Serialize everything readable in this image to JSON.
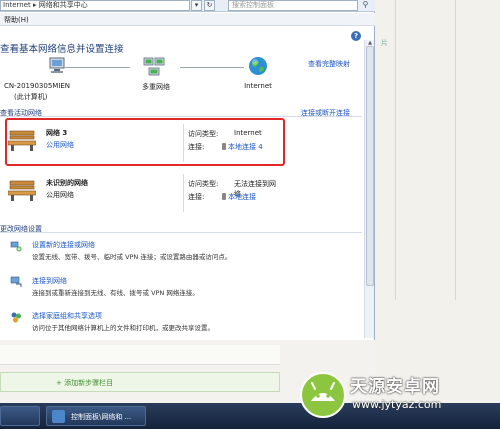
{
  "address": {
    "path": "Internet  ▸  网络和共享中心",
    "search_placeholder": "搜索控制面板"
  },
  "menu": {
    "help": "帮助(H)"
  },
  "title": "查看基本网络信息并设置连接",
  "map": {
    "link": "查看完整映射",
    "computer_name": "CN-20190305MIEN",
    "computer_sub": "(此计算机)",
    "network": "多重网络",
    "internet": "Internet"
  },
  "active_section": {
    "label": "查看活动网络",
    "link": "连接或断开连接"
  },
  "networks": [
    {
      "name": "网络  3",
      "type": "公用网络",
      "access_label": "访问类型:",
      "access_value": "Internet",
      "conn_label": "连接:",
      "conn_value": "本地连接 4"
    },
    {
      "name": "未识别的网络",
      "type": "公用网络",
      "access_label": "访问类型:",
      "access_value": "无法连接到网络",
      "conn_label": "连接:",
      "conn_value": "本地连接"
    }
  ],
  "settings_section": {
    "label": "更改网络设置"
  },
  "tasks": [
    {
      "title": "设置新的连接或网络",
      "desc": "设置无线、宽带、拨号、临时或 VPN 连接；或设置路由器或访问点。"
    },
    {
      "title": "连接到网络",
      "desc": "连接到或重新连接到无线、有线、拨号或 VPN 网络连接。"
    },
    {
      "title": "选择家庭组和共享选项",
      "desc": "访问位于其他网络计算机上的文件和打印机，或更改共享设置。"
    }
  ],
  "background": {
    "side_text": "片",
    "add_link": "+ 添加新步骤栏目"
  },
  "taskbar": {
    "item": "控制面板\\网络和 ..."
  },
  "watermark": {
    "name": "天源安卓网",
    "url": "www.jytyaz.com"
  }
}
